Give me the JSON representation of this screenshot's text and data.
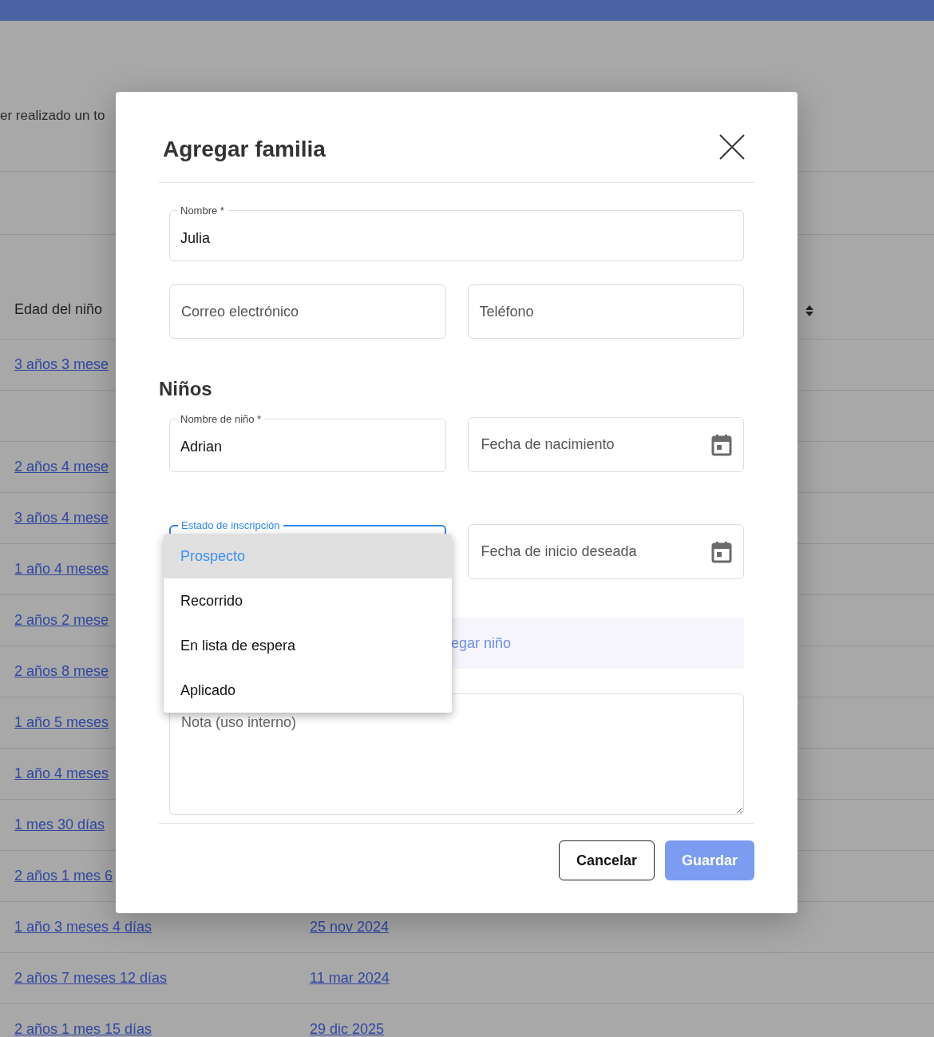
{
  "background": {
    "notice": "er realizado un to",
    "table": {
      "columns": [
        {
          "label": "Edad del niño"
        }
      ],
      "rows": [
        {
          "age": "3 años 3 mese"
        },
        {
          "age": ""
        },
        {
          "age": "2 años 4 mese"
        },
        {
          "age": "3 años 4 mese"
        },
        {
          "age": "1 año 4 meses"
        },
        {
          "age": "2 años 2 mese"
        },
        {
          "age": "2 años 8 mese"
        },
        {
          "age": "1 año 5 meses"
        },
        {
          "age": "1 año 4 meses"
        },
        {
          "age": "1 mes 30 días"
        },
        {
          "age": "2 años 1 mes 6"
        },
        {
          "age": "1 año 3 meses 4 días",
          "date": "25 nov 2024"
        },
        {
          "age": "2 años 7 meses 12 días",
          "date": "11 mar 2024"
        },
        {
          "age": "2 años 1 mes 15 días",
          "date": "29 dic 2025"
        }
      ]
    }
  },
  "modal": {
    "title": "Agregar familia",
    "name_field": {
      "label": "Nombre *",
      "value": "Julia"
    },
    "email_field": {
      "placeholder": "Correo electrónico"
    },
    "phone_field": {
      "placeholder": "Teléfono"
    },
    "children_heading": "Niños",
    "child_name_field": {
      "label": "Nombre de niño *",
      "value": "Adrian"
    },
    "birth_date_field": {
      "placeholder": "Fecha de nacimiento"
    },
    "enrollment_field": {
      "label": "Estado de inscripción",
      "focused": true,
      "options": [
        {
          "label": "Prospecto",
          "selected": true
        },
        {
          "label": "Recorrido",
          "selected": false
        },
        {
          "label": "En lista de espera",
          "selected": false
        },
        {
          "label": "Aplicado",
          "selected": false
        }
      ]
    },
    "start_date_field": {
      "placeholder": "Fecha de inicio deseada"
    },
    "add_child_button": "egar niño",
    "note_field": {
      "placeholder": "Nota (uso interno)"
    },
    "buttons": [
      {
        "label": "Cancelar",
        "kind": "secondary"
      },
      {
        "label": "Guardar",
        "kind": "primary"
      }
    ]
  }
}
